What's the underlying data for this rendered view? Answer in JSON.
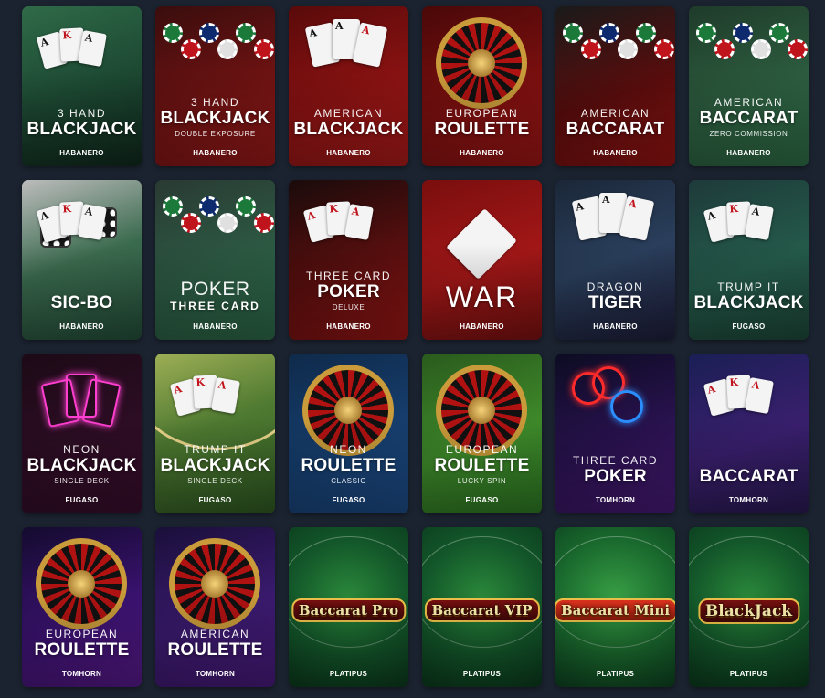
{
  "games": [
    {
      "pre": "3 Hand",
      "main": "Blackjack",
      "sub": "",
      "provider": "HABANERO",
      "bg": "linear-gradient(160deg,#2f6a48 0%,#1d4a33 50%,#10291d 100%)",
      "deco": "cards"
    },
    {
      "pre": "3 Hand",
      "main": "Blackjack",
      "sub": "Double Exposure",
      "provider": "HABANERO",
      "bg": "linear-gradient(160deg,#3a0d0d 0%,#6e1212 55%,#9e1a1a 100%)",
      "deco": "chips"
    },
    {
      "pre": "American",
      "main": "Blackjack",
      "sub": "",
      "provider": "HABANERO",
      "bg": "linear-gradient(160deg,#5a0a0a 0%,#8a1212 55%,#b01b1b 100%)",
      "deco": "aces"
    },
    {
      "pre": "European",
      "main": "Roulette",
      "sub": "",
      "provider": "HABANERO",
      "bg": "linear-gradient(160deg,#4a0808 0%,#7a0f0f 55%,#a11616 100%)",
      "deco": "roulette"
    },
    {
      "pre": "American",
      "main": "Baccarat",
      "sub": "",
      "provider": "HABANERO",
      "bg": "linear-gradient(160deg,#1a1a1a 0%,#5a0c0c 55%,#9b1414 100%)",
      "deco": "chips"
    },
    {
      "pre": "American",
      "main": "Baccarat",
      "sub": "Zero Commission",
      "provider": "HABANERO",
      "bg": "linear-gradient(160deg,#1f3b2a 0%,#2c5c3f 55%,#2f7048 100%)",
      "deco": "chips"
    },
    {
      "pre": "",
      "main": "Sic-Bo",
      "sub": "",
      "provider": "HABANERO",
      "bg": "linear-gradient(160deg,#bcbcbc 0%,#3b6b4f 50%,#24503a 100%)",
      "deco": "dice"
    },
    {
      "pre": "Poker",
      "main": "Three Card",
      "sub": "",
      "provider": "HABANERO",
      "bg": "linear-gradient(160deg,#2a3a33 0%,#2c5a43 55%,#2d6b4a 100%)",
      "deco": "chips",
      "variant": "poker3"
    },
    {
      "pre": "Three Card",
      "main": "Poker",
      "sub": "Deluxe",
      "provider": "HABANERO",
      "bg": "linear-gradient(160deg,#1a0b0b 0%,#5a0e0e 55%,#a01616 100%)",
      "deco": "cards"
    },
    {
      "pre": "",
      "main": "War",
      "sub": "",
      "provider": "HABANERO",
      "bg": "linear-gradient(160deg,#7a0e0e 0%,#a31717 55%,#7e1111 100%)",
      "deco": "war"
    },
    {
      "pre": "Dragon",
      "main": "Tiger",
      "sub": "",
      "provider": "HABANERO",
      "bg": "linear-gradient(160deg,#1b2738 0%,#2a3f5c 50%,#1f1e3c 100%)",
      "deco": "aces"
    },
    {
      "pre": "Trump It",
      "main": "Blackjack",
      "sub": "",
      "provider": "FUGASO",
      "bg": "linear-gradient(160deg,#1e3a3a 0%,#245a4a 55%,#1e4a3b 100%)",
      "deco": "cards"
    },
    {
      "pre": "Neon",
      "main": "Blackjack",
      "sub": "Single Deck",
      "provider": "FUGASO",
      "bg": "linear-gradient(160deg,#1c0a16 0%,#2d0d24 55%,#3a0d2d 100%)",
      "deco": "neoncards"
    },
    {
      "pre": "Trump It",
      "main": "Blackjack",
      "sub": "Single Deck",
      "provider": "FUGASO",
      "bg": "linear-gradient(160deg,#9dae55 0%,#4f7a31 45%,#2e5a22 100%)",
      "deco": "table"
    },
    {
      "pre": "Neon",
      "main": "Roulette",
      "sub": "Classic",
      "provider": "FUGASO",
      "bg": "linear-gradient(160deg,#0f2a4a 0%,#163e6e 55%,#1d4d8a 100%)",
      "deco": "roulette"
    },
    {
      "pre": "European",
      "main": "Roulette",
      "sub": "Lucky Spin",
      "provider": "FUGASO",
      "bg": "linear-gradient(160deg,#2a5a1d 0%,#3e8a2a 55%,#2e7a24 100%)",
      "deco": "roulette"
    },
    {
      "pre": "Three Card",
      "main": "Poker",
      "sub": "",
      "provider": "TOMHORN",
      "bg": "linear-gradient(160deg,#0c0c22 0%,#2a1250 55%,#4a1a7a 100%)",
      "deco": "neonchips"
    },
    {
      "pre": "",
      "main": "Baccarat",
      "sub": "",
      "provider": "TOMHORN",
      "bg": "linear-gradient(160deg,#1a1f55 0%,#3a1f6e 55%,#2a1a55 100%)",
      "deco": "cards"
    },
    {
      "pre": "European",
      "main": "Roulette",
      "sub": "",
      "provider": "TOMHORN",
      "bg": "linear-gradient(160deg,#140b2e 0%,#3a1270 55%,#5a1a8e 100%)",
      "deco": "roulette"
    },
    {
      "pre": "American",
      "main": "Roulette",
      "sub": "",
      "provider": "TOMHORN",
      "bg": "linear-gradient(160deg,#1a0f3a 0%,#3a1a6e 55%,#4a1a7e 100%)",
      "deco": "roulette"
    },
    {
      "pre": "",
      "main": "",
      "sub": "",
      "provider": "PLATIPUS",
      "bg": "radial-gradient(circle at 50% 45%,#2b8a3a 0%,#13572a 55%,#0b3a1d 100%)",
      "deco": "badge",
      "badge": "Baccarat Pro"
    },
    {
      "pre": "",
      "main": "",
      "sub": "",
      "provider": "PLATIPUS",
      "bg": "radial-gradient(circle at 50% 45%,#2b8a3a 0%,#13572a 55%,#0b3a1d 100%)",
      "deco": "badge",
      "badge": "Baccarat VIP"
    },
    {
      "pre": "",
      "main": "",
      "sub": "",
      "provider": "PLATIPUS",
      "bg": "radial-gradient(circle at 50% 45%,#38a045 0%,#1a6a2e 55%,#0d4220 100%)",
      "deco": "badge",
      "badge": "Baccarat Mini"
    },
    {
      "pre": "",
      "main": "",
      "sub": "",
      "provider": "PLATIPUS",
      "bg": "radial-gradient(circle at 50% 45%,#2b8a3a 0%,#13572a 55%,#0b3a1d 100%)",
      "deco": "badge",
      "badge": "BlackJack"
    }
  ]
}
